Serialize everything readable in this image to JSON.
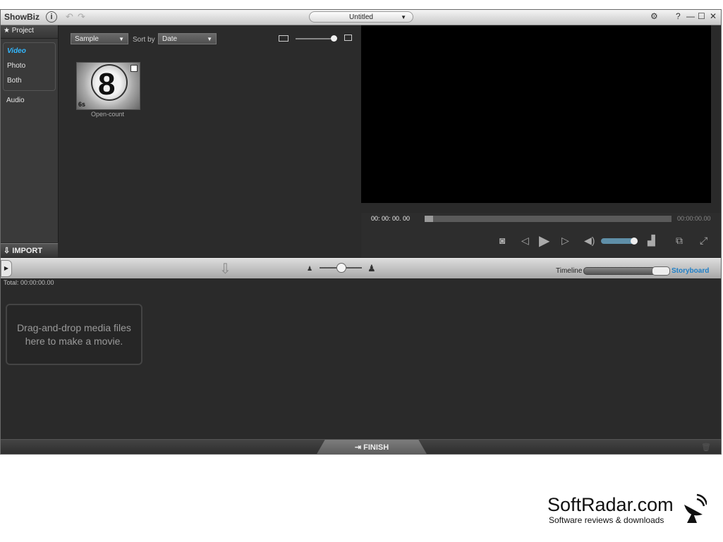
{
  "titlebar": {
    "app_name": "ShowBiz",
    "info_glyph": "i",
    "undo_glyph": "↶",
    "redo_glyph": "↷",
    "document": "Untitled",
    "settings_glyph": "⚙",
    "help_glyph": "?",
    "minimize_glyph": "—",
    "maximize_glyph": "☐",
    "close_glyph": "✕"
  },
  "sidebar": {
    "project_label": "Project",
    "items": [
      {
        "label": "Video",
        "active": true
      },
      {
        "label": "Photo"
      },
      {
        "label": "Both"
      }
    ],
    "audio_label": "Audio",
    "import_label": "IMPORT"
  },
  "library": {
    "folder": "Sample",
    "sort_label": "Sort by",
    "sort_value": "Date",
    "thumb_size_level": 0.95,
    "clip": {
      "duration": "6s",
      "name": "Open-count",
      "numeral": "8"
    }
  },
  "player": {
    "timecode": "00: 00: 00. 00",
    "duration": "00:00:00.00",
    "volume_level": 0.85
  },
  "storybar": {
    "timeline_label": "Timeline",
    "storyboard_label": "Storyboard",
    "zoom_level": 0.5,
    "expand_glyph": "▶"
  },
  "storyboard": {
    "total": "Total:   00:00:00.00",
    "drop_hint": "Drag-and-drop media files here to make a movie."
  },
  "footer": {
    "finish_label": "FINISH"
  },
  "watermark": {
    "title": "SoftRadar.com",
    "subtitle": "Software reviews & downloads"
  },
  "colors": {
    "accent": "#33b8ff",
    "storyboard_blue": "#1f7fc7",
    "volume": "#5f8fa8"
  }
}
